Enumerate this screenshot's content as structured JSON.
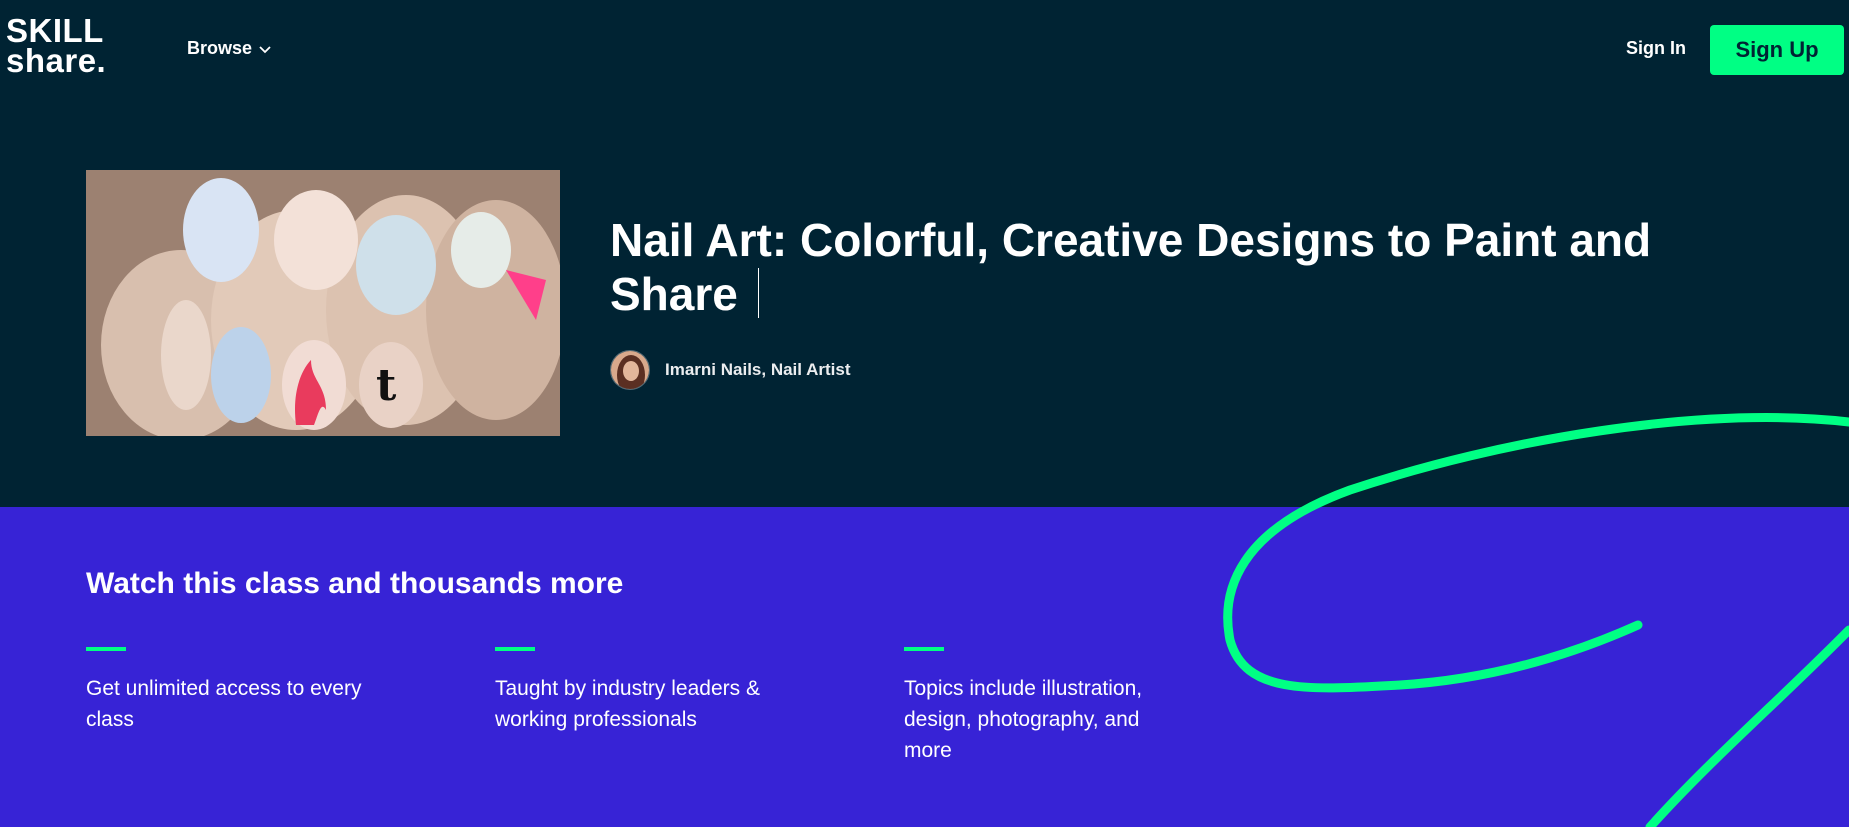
{
  "header": {
    "logo_line1": "SKILL",
    "logo_line2": "share.",
    "browse_label": "Browse",
    "signin_label": "Sign In",
    "signup_label": "Sign Up"
  },
  "hero": {
    "title": "Nail Art: Colorful, Creative Designs to Paint and Share",
    "teacher": "Imarni Nails, Nail Artist"
  },
  "promo": {
    "heading": "Watch this class and thousands more",
    "features": [
      {
        "text": "Get unlimited access to every class"
      },
      {
        "text": "Taught by industry leaders & working professionals"
      },
      {
        "text": "Topics include illustration, design, photography, and more"
      }
    ]
  },
  "colors": {
    "navy": "#002333",
    "accent_green": "#00ff84",
    "promo_purple": "#3723d6"
  },
  "icons": [
    "chevron-down-icon"
  ]
}
